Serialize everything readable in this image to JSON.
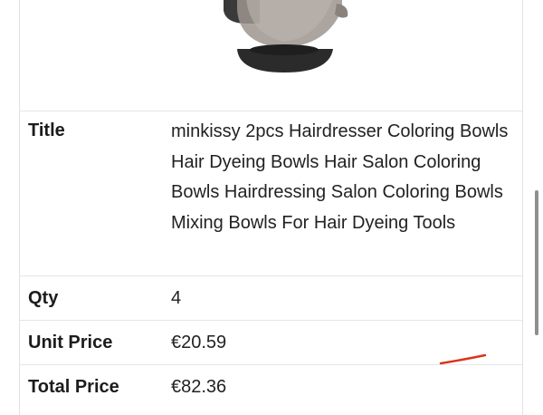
{
  "product": {
    "image_alt": "Hair coloring bowls",
    "title_label": "Title",
    "title_value": "minkissy 2pcs Hairdresser Coloring Bowls Hair Dyeing Bowls Hair Salon Coloring Bowls Hairdressing Salon Coloring Bowls Mixing Bowls For Hair Dyeing Tools",
    "qty_label": "Qty",
    "qty_value": "4",
    "unit_price_label": "Unit Price",
    "unit_price_value": "€20.59",
    "total_price_label": "Total Price",
    "total_price_value": "€82.36"
  },
  "colors": {
    "annotation_stroke": "#d9351f",
    "border": "#e6e6e6",
    "scrollbar": "#8e8e8e"
  }
}
